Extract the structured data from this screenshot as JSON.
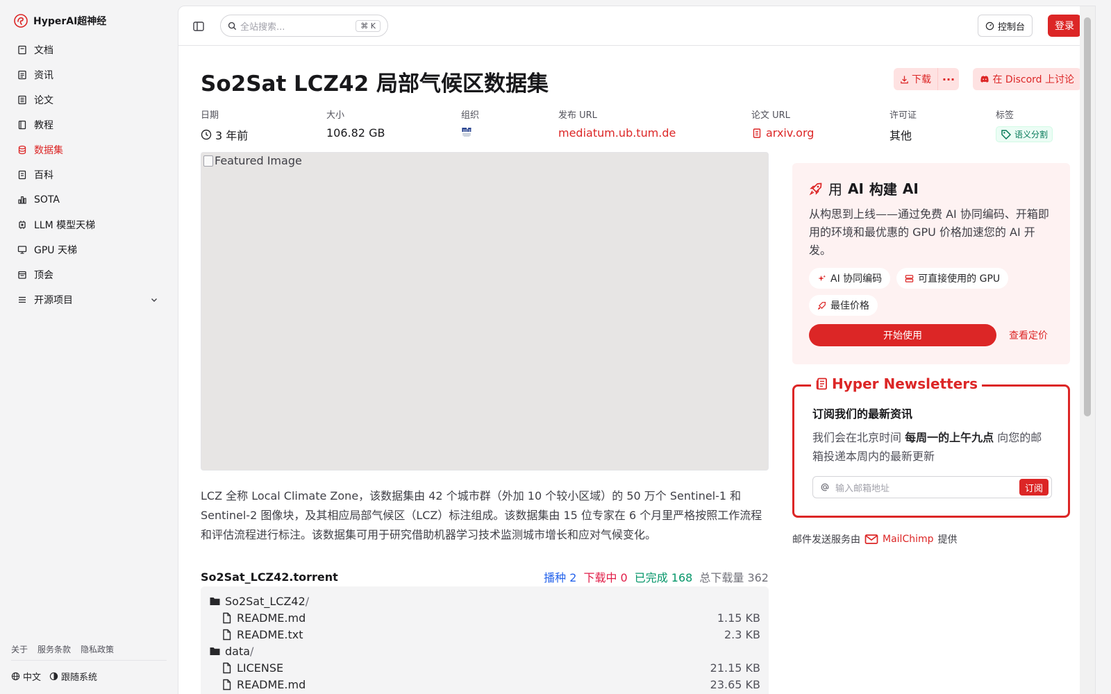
{
  "brand": {
    "name": "HyperAI超神经"
  },
  "sidebar": {
    "items": [
      {
        "label": "文档",
        "icon": "book-icon"
      },
      {
        "label": "资讯",
        "icon": "newspaper-icon"
      },
      {
        "label": "论文",
        "icon": "file-text-icon"
      },
      {
        "label": "教程",
        "icon": "notebook-icon"
      },
      {
        "label": "数据集",
        "icon": "database-icon",
        "active": true
      },
      {
        "label": "百科",
        "icon": "book-open-icon"
      },
      {
        "label": "SOTA",
        "icon": "bar-chart-icon"
      },
      {
        "label": "LLM 模型天梯",
        "icon": "cpu-icon"
      },
      {
        "label": "GPU 天梯",
        "icon": "monitor-icon"
      },
      {
        "label": "顶会",
        "icon": "calendar-icon"
      },
      {
        "label": "开源项目",
        "icon": "list-icon"
      }
    ],
    "footer_links": [
      "关于",
      "服务条款",
      "隐私政策"
    ],
    "language": "中文",
    "theme": "跟随系统"
  },
  "topbar": {
    "search_placeholder": "全站搜索...",
    "search_shortcut": "⌘ K",
    "console_label": "控制台",
    "login_label": "登录"
  },
  "dataset": {
    "title": "So2Sat LCZ42 局部气候区数据集",
    "download_label": "下载",
    "more_label": "···",
    "discord_label": "在 Discord 上讨论",
    "meta": {
      "date_label": "日期",
      "date_value": "3 年前",
      "size_label": "大小",
      "size_value": "106.82 GB",
      "org_label": "组织",
      "url_label": "发布 URL",
      "url_value": "mediatum.ub.tum.de",
      "paper_label": "论文 URL",
      "paper_value": "arxiv.org",
      "license_label": "许可证",
      "license_value": "其他",
      "tags_label": "标签",
      "tag_value": "语义分割"
    },
    "featured_alt": "Featured Image",
    "description": "LCZ 全称 Local Climate Zone，该数据集由 42 个城市群（外加 10 个较小区域）的 50 万个 Sentinel-1 和 Sentinel-2 图像块，及其相应局部气候区（LCZ）标注组成。该数据集由 15 位专家在 6 个月里严格按照工作流程和评估流程进行标注。该数据集可用于研究借助机器学习技术监测城市增长和应对气候变化。"
  },
  "torrent": {
    "name": "So2Sat_LCZ42.torrent",
    "seed": "播种 2",
    "downloading": "下载中 0",
    "completed": "已完成 168",
    "total": "总下载量 362",
    "files": [
      {
        "name": "So2Sat_LCZ42",
        "type": "folder",
        "size": ""
      },
      {
        "name": "README.md",
        "type": "file",
        "size": "1.15 KB"
      },
      {
        "name": "README.txt",
        "type": "file",
        "size": "2.3 KB"
      },
      {
        "name": "data",
        "type": "folder",
        "size": ""
      },
      {
        "name": "LICENSE",
        "type": "file",
        "size": "21.15 KB"
      },
      {
        "name": "README.md",
        "type": "file",
        "size": "23.65 KB"
      }
    ]
  },
  "promo": {
    "title_prefix": "用",
    "title_ai1": "AI",
    "title_mid": "构建",
    "title_ai2": "AI",
    "text": "从构思到上线——通过免费 AI 协同编码、开箱即用的环境和最优惠的 GPU 价格加速您的 AI 开发。",
    "chip1": "AI 协同编码",
    "chip2": "可直接使用的 GPU",
    "chip3": "最佳价格",
    "start_label": "开始使用",
    "pricing_label": "查看定价"
  },
  "newsletter": {
    "title": "Hyper Newsletters",
    "heading": "订阅我们的最新资讯",
    "text_before": "我们会在北京时间",
    "text_bold": "每周一的上午九点",
    "text_after": "向您的邮箱投递本周内的最新更新",
    "input_placeholder": "输入邮箱地址",
    "subscribe_label": "订阅",
    "service_prefix": "邮件发送服务由",
    "service_name": "MailChimp",
    "service_suffix": "提供"
  },
  "colors": {
    "accent": "#dc2626",
    "accent_soft": "#fee2e2",
    "sidebar_bg": "#f4f4f5"
  }
}
